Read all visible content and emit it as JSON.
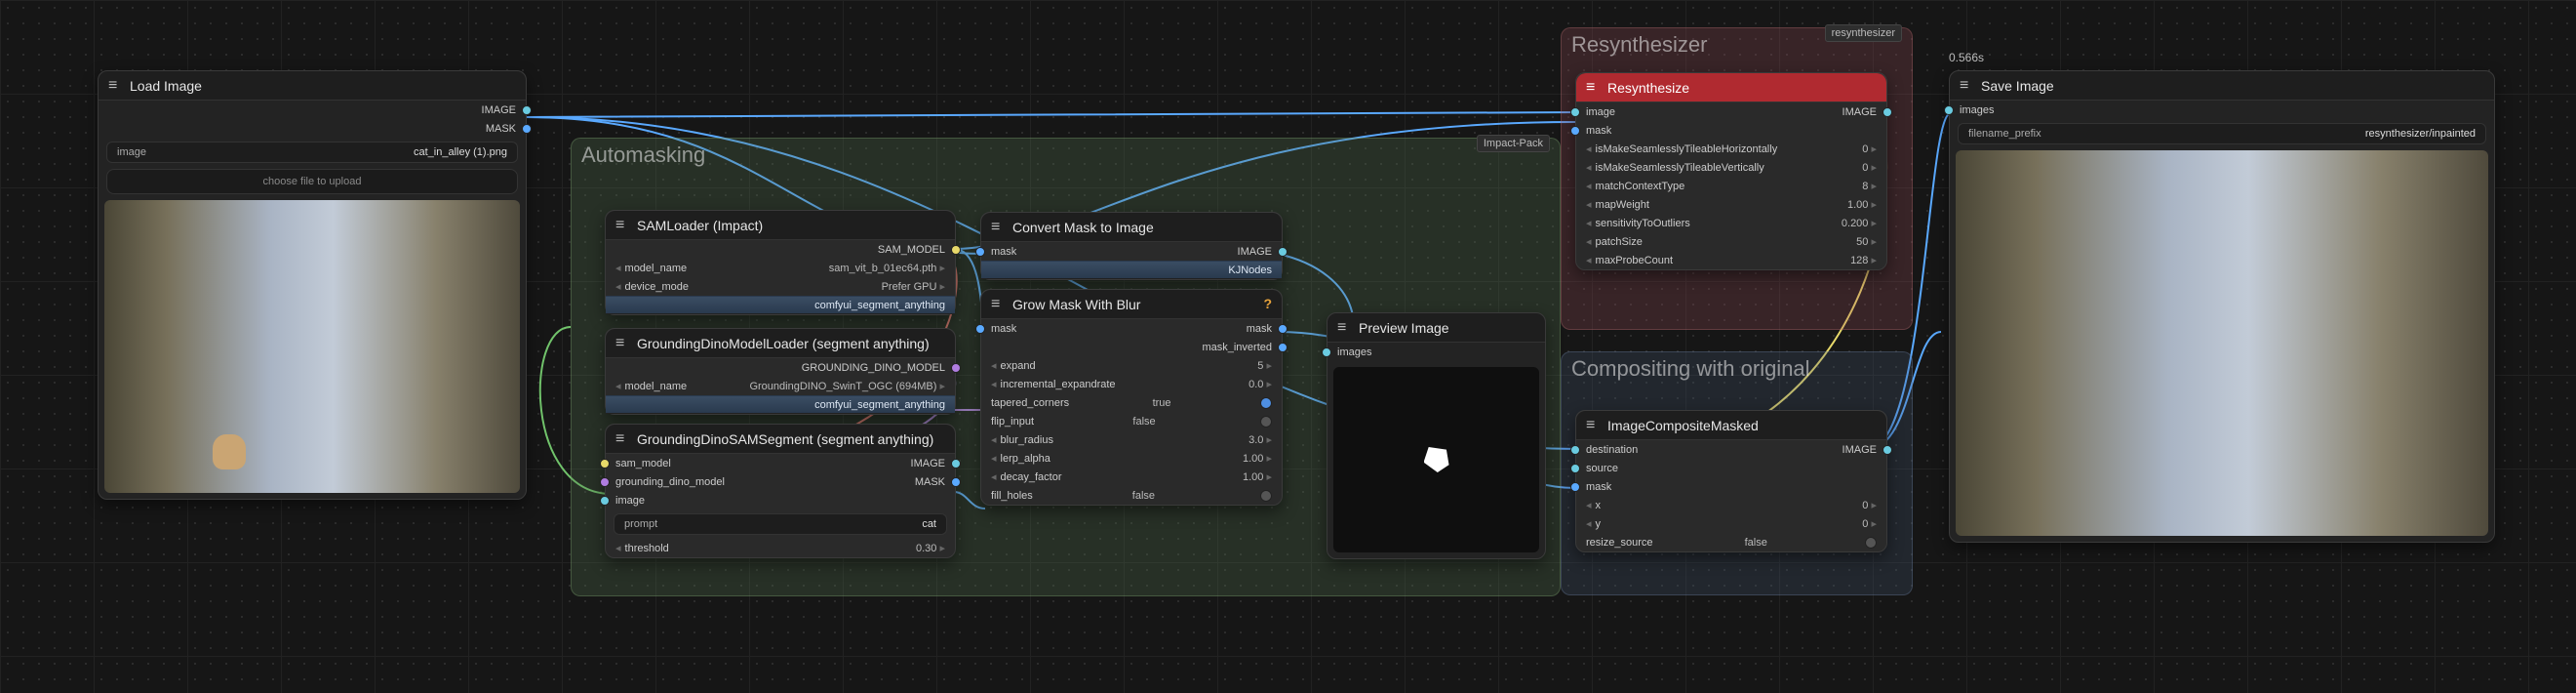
{
  "groups": {
    "automasking": {
      "title": "Automasking",
      "badge": "Impact-Pack"
    },
    "resynthesizer": {
      "title": "Resynthesizer",
      "badge": "resynthesizer"
    },
    "compositing": {
      "title": "Compositing with original"
    }
  },
  "nodes": {
    "loadImage": {
      "title": "Load Image",
      "outputs": [
        "IMAGE",
        "MASK"
      ],
      "widgets": [
        {
          "label": "image",
          "value": "cat_in_alley (1).png"
        }
      ],
      "upload": "choose file to upload"
    },
    "samLoader": {
      "title": "SAMLoader (Impact)",
      "outputs": [
        "SAM_MODEL"
      ],
      "widgets": [
        {
          "label": "model_name",
          "value": "sam_vit_b_01ec64.pth"
        },
        {
          "label": "device_mode",
          "value": "Prefer GPU"
        }
      ],
      "footer": "comfyui_segment_anything"
    },
    "gdLoader": {
      "title": "GroundingDinoModelLoader (segment anything)",
      "outputs": [
        "GROUNDING_DINO_MODEL"
      ],
      "widgets": [
        {
          "label": "model_name",
          "value": "GroundingDINO_SwinT_OGC (694MB)"
        }
      ],
      "footer": "comfyui_segment_anything"
    },
    "gdSam": {
      "title": "GroundingDinoSAMSegment (segment anything)",
      "inputs": [
        "sam_model",
        "grounding_dino_model",
        "image"
      ],
      "outputs": [
        "IMAGE",
        "MASK"
      ],
      "widgets": [
        {
          "label": "prompt",
          "value": "cat"
        },
        {
          "label": "threshold",
          "value": "0.30"
        }
      ]
    },
    "maskToImage": {
      "title": "Convert Mask to Image",
      "inputs": [
        "mask"
      ],
      "outputs": [
        "IMAGE"
      ],
      "footer": "KJNodes"
    },
    "growMask": {
      "title": "Grow Mask With Blur",
      "inputs": [
        "mask"
      ],
      "outputs": [
        "mask",
        "mask_inverted"
      ],
      "widgets": [
        {
          "label": "expand",
          "value": "5"
        },
        {
          "label": "incremental_expandrate",
          "value": "0.0"
        },
        {
          "label": "tapered_corners",
          "value": "true"
        },
        {
          "label": "flip_input",
          "value": "false"
        },
        {
          "label": "blur_radius",
          "value": "3.0"
        },
        {
          "label": "lerp_alpha",
          "value": "1.00"
        },
        {
          "label": "decay_factor",
          "value": "1.00"
        },
        {
          "label": "fill_holes",
          "value": "false"
        }
      ]
    },
    "preview": {
      "title": "Preview Image",
      "inputs": [
        "images"
      ]
    },
    "resynth": {
      "title": "Resynthesize",
      "inputs": [
        "image",
        "mask"
      ],
      "outputs": [
        "IMAGE"
      ],
      "widgets": [
        {
          "label": "isMakeSeamlesslyTileableHorizontally",
          "value": "0"
        },
        {
          "label": "isMakeSeamlesslyTileableVertically",
          "value": "0"
        },
        {
          "label": "matchContextType",
          "value": "8"
        },
        {
          "label": "mapWeight",
          "value": "1.00"
        },
        {
          "label": "sensitivityToOutliers",
          "value": "0.200"
        },
        {
          "label": "patchSize",
          "value": "50"
        },
        {
          "label": "maxProbeCount",
          "value": "128"
        }
      ]
    },
    "composite": {
      "title": "ImageCompositeMasked",
      "inputs": [
        "destination",
        "source",
        "mask"
      ],
      "outputs": [
        "IMAGE"
      ],
      "widgets": [
        {
          "label": "x",
          "value": "0"
        },
        {
          "label": "y",
          "value": "0"
        },
        {
          "label": "resize_source",
          "value": "false"
        }
      ]
    },
    "saveImage": {
      "title": "Save Image",
      "timing": "0.566s",
      "inputs": [
        "images"
      ],
      "widgets": [
        {
          "label": "filename_prefix",
          "value": "resynthesizer/inpainted"
        }
      ]
    }
  }
}
